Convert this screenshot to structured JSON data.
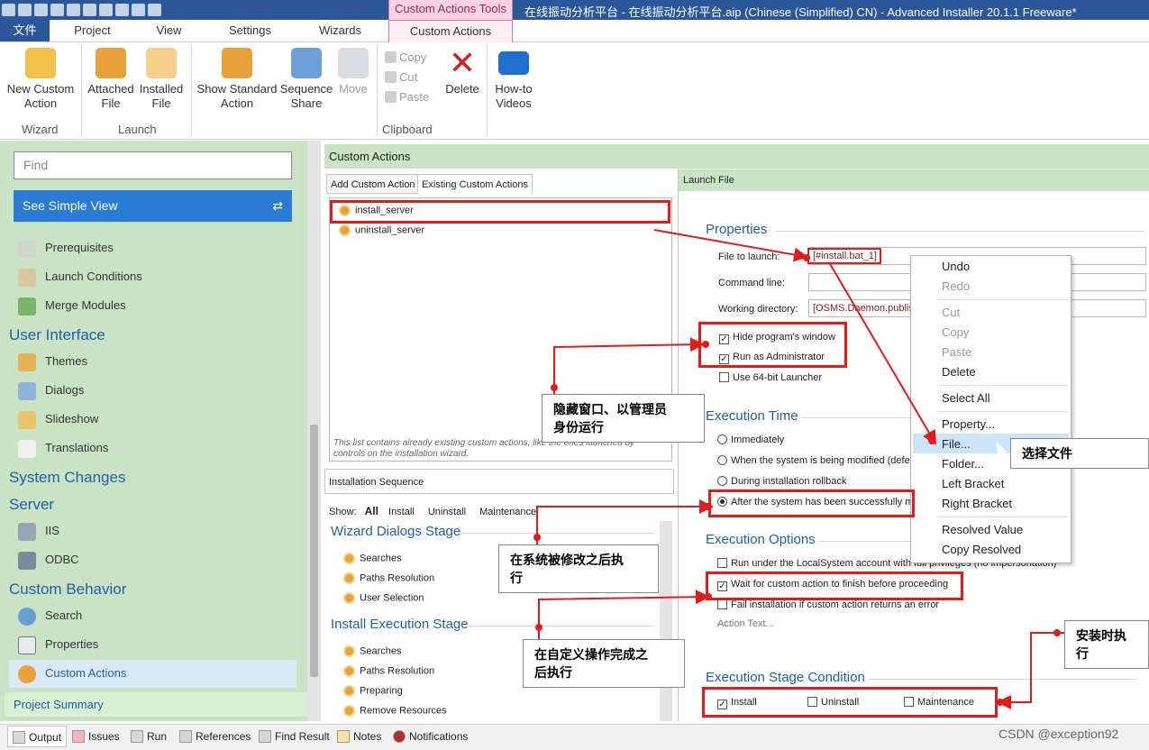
{
  "titlebar": {
    "title": "在线振动分析平台 - 在线振动分析平台.aip (Chinese (Simplified) CN) - Advanced Installer 20.1.1 Freeware*",
    "context_tab_group": "Custom Actions Tools"
  },
  "ribbon_tabs": [
    "文件",
    "Project",
    "View",
    "Settings",
    "Wizards",
    "Custom Actions"
  ],
  "ribbon": {
    "new_custom_action": "New Custom\nAction",
    "attached_file": "Attached\nFile",
    "installed_file": "Installed\nFile",
    "show_standard_action": "Show Standard\nAction",
    "sequence_share": "Sequence\nShare",
    "move": "Move",
    "copy": "Copy",
    "cut": "Cut",
    "paste": "Paste",
    "delete": "Delete",
    "howto": "How-to\nVideos",
    "groups": {
      "wizard": "Wizard",
      "launch": "Launch",
      "clipboard": "Clipboard"
    }
  },
  "sidebar": {
    "find_placeholder": "Find",
    "simple_view": "See Simple View",
    "items": {
      "prerequisites": "Prerequisites",
      "launch_conditions": "Launch Conditions",
      "merge_modules": "Merge Modules",
      "user_interface": "User Interface",
      "themes": "Themes",
      "dialogs": "Dialogs",
      "slideshow": "Slideshow",
      "translations": "Translations",
      "system_changes": "System Changes",
      "server": "Server",
      "iis": "IIS",
      "odbc": "ODBC",
      "custom_behavior": "Custom Behavior",
      "search": "Search",
      "properties": "Properties",
      "custom_actions": "Custom Actions",
      "project_summary": "Project Summary"
    }
  },
  "main": {
    "header": "Custom Actions",
    "subtabs": [
      "Add Custom Action",
      "Existing Custom Actions"
    ],
    "actions": [
      "install_server",
      "uninstall_server"
    ],
    "list_note": "This list contains already existing custom actions, like the ones launched by controls on the installation wizard.",
    "sequence": {
      "header": "Installation Sequence",
      "show_label": "Show:",
      "filters": [
        "All",
        "Install",
        "Uninstall",
        "Maintenance"
      ],
      "wizard_stage": "Wizard Dialogs Stage",
      "wizard_items": [
        "Searches",
        "Paths Resolution",
        "User Selection"
      ],
      "install_stage": "Install Execution Stage",
      "install_items": [
        "Searches",
        "Paths Resolution",
        "Preparing",
        "Remove Resources"
      ]
    }
  },
  "right": {
    "header": "Launch File",
    "properties_title": "Properties",
    "file_to_launch_label": "File to launch:",
    "file_to_launch_value": "[#install.bat_1]",
    "command_line_label": "Command line:",
    "working_dir_label": "Working directory:",
    "working_dir_value": "[OSMS.Daemon.publish",
    "hide_window": "Hide program's window",
    "run_admin": "Run as Administrator",
    "use64": "Use 64-bit Launcher",
    "exec_time_title": "Execution Time",
    "immediately": "Immediately",
    "when_modified": "When the system is being modified (defer",
    "during_rollback": "During installation rollback",
    "after_success": "After the system has been successfully m",
    "exec_options_title": "Execution Options",
    "run_localsystem": "Run under the LocalSystem account with full privileges (no impersonation)",
    "wait_finish": "Wait for custom action to finish before proceeding",
    "fail_install": "Fail installation if custom action returns an error",
    "action_text": "Action Text...",
    "stage_cond_title": "Execution Stage Condition",
    "cond_install": "Install",
    "cond_uninstall": "Uninstall",
    "cond_maintenance": "Maintenance"
  },
  "context_menu": [
    "Undo",
    "Redo",
    "Cut",
    "Copy",
    "Paste",
    "Delete",
    "Select All",
    "Property...",
    "File...",
    "Folder...",
    "Left Bracket",
    "Right Bracket",
    "Resolved Value",
    "Copy Resolved"
  ],
  "annotations": {
    "hide_admin": "隐藏窗口、以管理员\n身份运行",
    "select_file": "选择文件",
    "after_modified": "在系统被修改之后执\n行",
    "after_custom": "在自定义操作完成之\n后执行",
    "on_install": "安装时执行"
  },
  "bottom_tabs": [
    "Output",
    "Issues",
    "Run",
    "References",
    "Find Result",
    "Notes",
    "Notifications"
  ],
  "watermark": "CSDN @exception92",
  "colors": {
    "accent_blue": "#2b579a",
    "sidebar_green": "#c9e3c4",
    "annotation_red": "#e21b1b",
    "context_pink": "#f9d2e3"
  }
}
